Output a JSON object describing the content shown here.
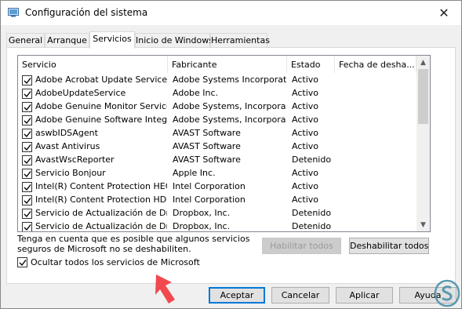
{
  "window": {
    "title": "Configuración del sistema",
    "close_symbol": "✕"
  },
  "tabs": [
    {
      "label": "General"
    },
    {
      "label": "Arranque"
    },
    {
      "label": "Servicios",
      "active": true
    },
    {
      "label": "Inicio de Windows"
    },
    {
      "label": "Herramientas"
    }
  ],
  "list": {
    "columns": [
      "Servicio",
      "Fabricante",
      "Estado",
      "Fecha de desha..."
    ],
    "rows": [
      {
        "checked": true,
        "service": "Adobe Acrobat Update Service",
        "manufacturer": "Adobe Systems Incorporated",
        "status": "Activo"
      },
      {
        "checked": true,
        "service": "AdobeUpdateService",
        "manufacturer": "Adobe Inc.",
        "status": "Activo"
      },
      {
        "checked": true,
        "service": "Adobe Genuine Monitor Service",
        "manufacturer": "Adobe Systems, Incorpora...",
        "status": "Activo"
      },
      {
        "checked": true,
        "service": "Adobe Genuine Software Integri...",
        "manufacturer": "Adobe Systems, Incorpora...",
        "status": "Activo"
      },
      {
        "checked": true,
        "service": "aswbIDSAgent",
        "manufacturer": "AVAST Software",
        "status": "Activo"
      },
      {
        "checked": true,
        "service": "Avast Antivirus",
        "manufacturer": "AVAST Software",
        "status": "Activo"
      },
      {
        "checked": true,
        "service": "AvastWscReporter",
        "manufacturer": "AVAST Software",
        "status": "Detenido"
      },
      {
        "checked": true,
        "service": "Servicio Bonjour",
        "manufacturer": "Apple Inc.",
        "status": "Activo"
      },
      {
        "checked": true,
        "service": "Intel(R) Content Protection HEC...",
        "manufacturer": "Intel Corporation",
        "status": "Activo"
      },
      {
        "checked": true,
        "service": "Intel(R) Content Protection HDC...",
        "manufacturer": "Intel Corporation",
        "status": "Activo"
      },
      {
        "checked": true,
        "service": "Servicio de Actualización de Dro...",
        "manufacturer": "Dropbox, Inc.",
        "status": "Detenido"
      },
      {
        "checked": true,
        "service": "Servicio de Actualización de Dro...",
        "manufacturer": "Dropbox, Inc.",
        "status": "Detenido"
      }
    ]
  },
  "note": {
    "line1": "Tenga en cuenta que es posible que algunos servicios",
    "line2": "seguros de Microsoft no se deshabiliten."
  },
  "buttons": {
    "enable_all": "Habilitar todos",
    "disable_all": "Deshabilitar todos",
    "accept": "Aceptar",
    "cancel": "Cancelar",
    "apply": "Aplicar",
    "help": "Ayuda"
  },
  "hide_ms": {
    "label": "Ocultar todos los servicios de Microsoft",
    "checked": true
  },
  "colors": {
    "annotation_arrow": "#f04a4f",
    "accent": "#0078d7"
  },
  "icons": {
    "app": "system-config-icon",
    "close": "close-icon",
    "arrow": "red-pointer-arrow-icon",
    "logo": "site-logo-icon"
  }
}
